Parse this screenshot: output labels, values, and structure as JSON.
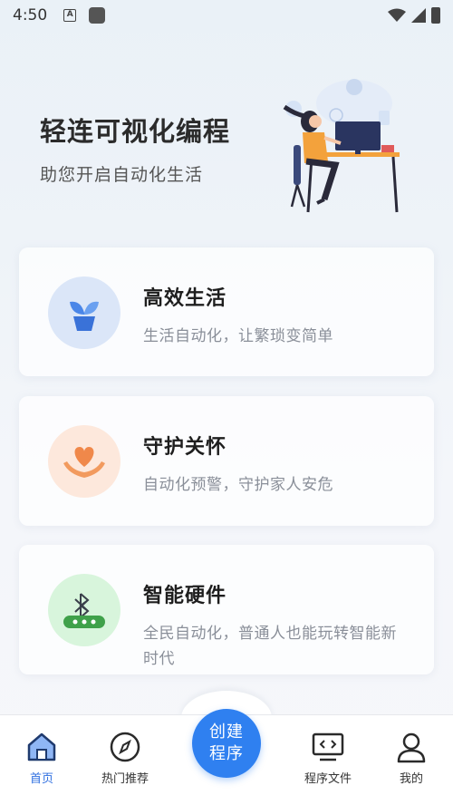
{
  "status": {
    "time": "4:50",
    "app_badge": "A"
  },
  "hero": {
    "title": "轻连可视化编程",
    "subtitle": "助您开启自动化生活"
  },
  "cards": [
    {
      "title": "高效生活",
      "desc": "生活自动化，让繁琐变简单",
      "icon": "plant-icon",
      "icon_bg": "#dbe6f8"
    },
    {
      "title": "守护关怀",
      "desc": "自动化预警，守护家人安危",
      "icon": "heart-hands-icon",
      "icon_bg": "#fde8dc"
    },
    {
      "title": "智能硬件",
      "desc": "全民自动化，普通人也能玩转智能新时代",
      "icon": "bluetooth-device-icon",
      "icon_bg": "#d8f5dc"
    }
  ],
  "tabbar": {
    "home_label": "首页",
    "hot_label": "热门推荐",
    "create_line1": "创建",
    "create_line2": "程序",
    "files_label": "程序文件",
    "mine_label": "我的"
  },
  "colors": {
    "accent": "#2f80f0",
    "active_tab": "#2f6fe0"
  }
}
